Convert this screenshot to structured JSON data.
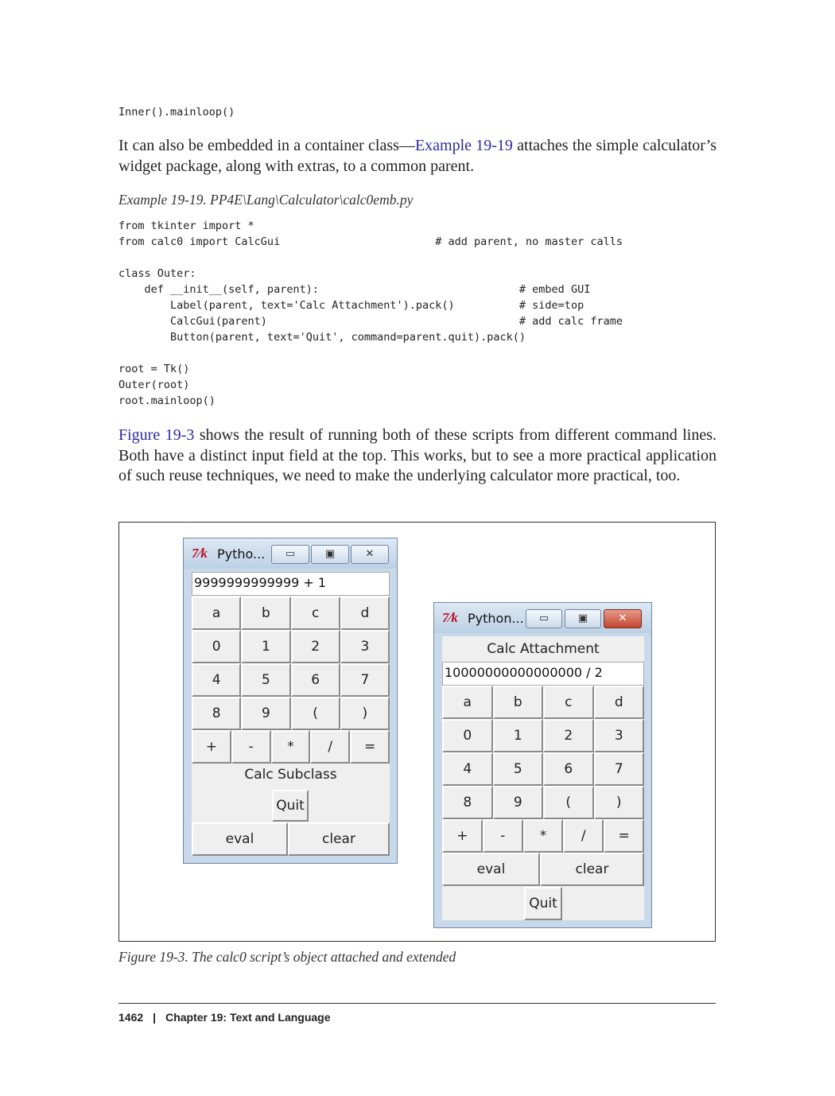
{
  "code_top": "Inner().mainloop()",
  "paragraph1": {
    "before": "It can also be embedded in a container class—",
    "link": "Example 19-19",
    "after": " attaches the simple calculator’s widget package, along with extras, to a common parent."
  },
  "example_caption": "Example 19-19. PP4E\\Lang\\Calculator\\calc0emb.py",
  "code_example": "from tkinter import *\nfrom calc0 import CalcGui                        # add parent, no master calls\n\nclass Outer:\n    def __init__(self, parent):                               # embed GUI\n        Label(parent, text='Calc Attachment').pack()          # side=top\n        CalcGui(parent)                                       # add calc frame\n        Button(parent, text='Quit', command=parent.quit).pack()\n\nroot = Tk()\nOuter(root)\nroot.mainloop()",
  "paragraph2": {
    "link": "Figure 19-3",
    "after": " shows the result of running both of these scripts from different command lines. Both have a distinct input field at the top. This works, but to see a more practical application of such reuse techniques, we need to make the underlying calculator more practical, too."
  },
  "window1": {
    "logo": "7⁄k",
    "title": "Pytho...",
    "entry": "9999999999999 + 1",
    "rows": [
      [
        "a",
        "b",
        "c",
        "d"
      ],
      [
        "0",
        "1",
        "2",
        "3"
      ],
      [
        "4",
        "5",
        "6",
        "7"
      ],
      [
        "8",
        "9",
        "(",
        ")"
      ],
      [
        "+",
        "-",
        "*",
        "/",
        "="
      ]
    ],
    "label": "Calc Subclass",
    "quit": "Quit",
    "eval": "eval",
    "clear": "clear"
  },
  "window2": {
    "logo": "7⁄k",
    "title": "Python...",
    "label": "Calc Attachment",
    "entry": "10000000000000000 / 2",
    "rows": [
      [
        "a",
        "b",
        "c",
        "d"
      ],
      [
        "0",
        "1",
        "2",
        "3"
      ],
      [
        "4",
        "5",
        "6",
        "7"
      ],
      [
        "8",
        "9",
        "(",
        ")"
      ],
      [
        "+",
        "-",
        "*",
        "/",
        "="
      ]
    ],
    "eval": "eval",
    "clear": "clear",
    "quit": "Quit"
  },
  "titlebar_buttons": {
    "minimize": "▭",
    "maximize": "▣",
    "close": "✕"
  },
  "figure_caption": "Figure 19-3. The calc0 script’s object attached and extended",
  "footer": {
    "page": "1462",
    "separator": "|",
    "chapter": "Chapter 19:  Text and Language"
  }
}
